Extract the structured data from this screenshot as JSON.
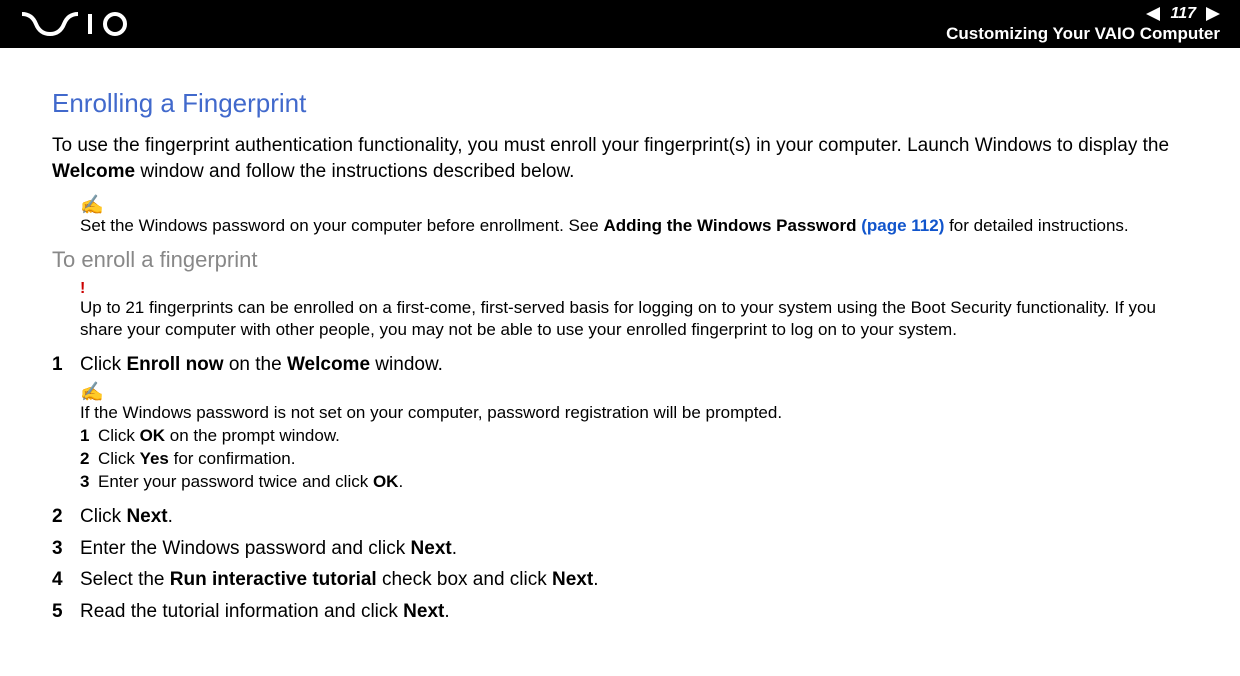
{
  "header": {
    "page_number": "117",
    "breadcrumb": "Customizing Your VAIO Computer"
  },
  "main": {
    "title": "Enrolling a Fingerprint",
    "intro_prefix": "To use the fingerprint authentication functionality, you must enroll your fingerprint(s) in your computer. Launch Windows to display the ",
    "intro_bold1": "Welcome",
    "intro_suffix": " window and follow the instructions described below.",
    "note_icon": "✍",
    "note_text_prefix": "Set the Windows password on your computer before enrollment. See ",
    "note_bold": "Adding the Windows Password ",
    "note_link": "(page 112)",
    "note_text_suffix": " for detailed instructions.",
    "sub_title": "To enroll a fingerprint",
    "alert_icon": "!",
    "alert_text": "Up to 21 fingerprints can be enrolled on a first-come, first-served basis for logging on to your system using the Boot Security functionality. If you share your computer with other people, you may not be able to use your enrolled fingerprint to log on to your system.",
    "steps": {
      "s1_num": "1",
      "s1_pre": "Click ",
      "s1_b1": "Enroll now",
      "s1_mid": " on the ",
      "s1_b2": "Welcome",
      "s1_suf": " window.",
      "subnote_icon": "✍",
      "subnote_text": "If the Windows password is not set on your computer, password registration will be prompted.",
      "ss1_num": "1",
      "ss1_pre": "Click ",
      "ss1_b": "OK",
      "ss1_suf": " on the prompt window.",
      "ss2_num": "2",
      "ss2_pre": "Click ",
      "ss2_b": "Yes",
      "ss2_suf": " for confirmation.",
      "ss3_num": "3",
      "ss3_pre": "Enter your password twice and click ",
      "ss3_b": "OK",
      "ss3_suf": ".",
      "s2_num": "2",
      "s2_pre": "Click ",
      "s2_b": "Next",
      "s2_suf": ".",
      "s3_num": "3",
      "s3_pre": "Enter the Windows password and click ",
      "s3_b": "Next",
      "s3_suf": ".",
      "s4_num": "4",
      "s4_pre": "Select the ",
      "s4_b1": "Run interactive tutorial",
      "s4_mid": " check box and click ",
      "s4_b2": "Next",
      "s4_suf": ".",
      "s5_num": "5",
      "s5_pre": "Read the tutorial information and click ",
      "s5_b": "Next",
      "s5_suf": "."
    }
  }
}
